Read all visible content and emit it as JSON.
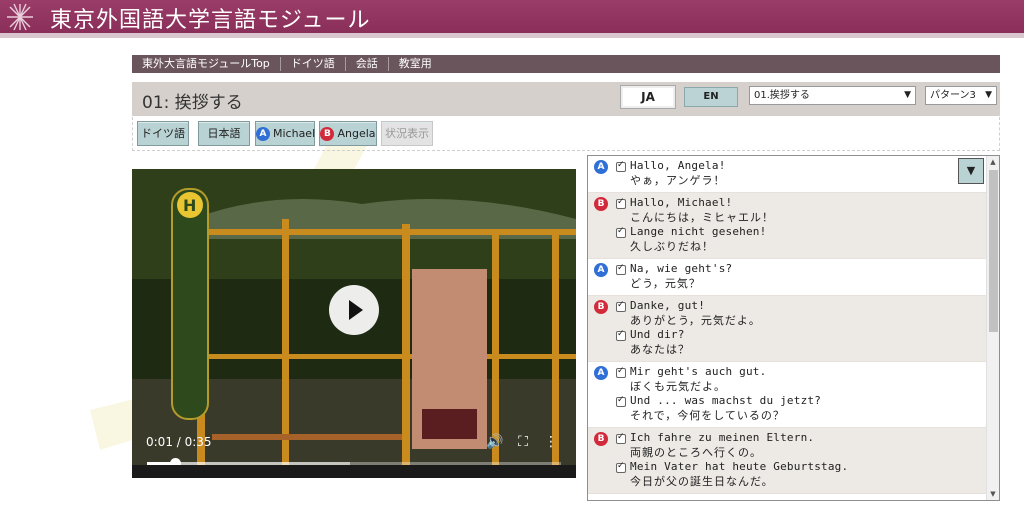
{
  "header": {
    "title": "東京外国語大学言語モジュール",
    "logo_icon": "snowflake-star-icon",
    "color_banner": "#8f3260"
  },
  "nav": {
    "items": [
      {
        "label": "東外大言語モジュールTop"
      },
      {
        "label": "ドイツ語"
      },
      {
        "label": "会話"
      },
      {
        "label": "教室用"
      }
    ]
  },
  "lesson": {
    "title": "01: 挨拶する",
    "lang_ja": "JA",
    "lang_en": "EN",
    "lesson_select": "01.挨拶する",
    "pattern_select": "パターン3"
  },
  "filters": {
    "german": "ドイツ語",
    "japanese": "日本語",
    "speaker_a_badge": "A",
    "speaker_a": "Michael",
    "speaker_b_badge": "B",
    "speaker_b": "Angela",
    "status": "状況表示"
  },
  "video": {
    "time": "0:01 / 0:35",
    "progress_fraction": 0.067,
    "buffered_fraction": 0.49,
    "volume_icon": "volume-icon",
    "fullscreen_icon": "fullscreen-icon",
    "menu_icon": "more-vert-icon",
    "play_icon": "play-icon"
  },
  "transcript": {
    "collapse_label": "▼",
    "turns": [
      {
        "speaker": "A",
        "lines": [
          {
            "de": "Hallo, Angela!",
            "ja": "やぁ，アンゲラ！"
          }
        ]
      },
      {
        "speaker": "B",
        "lines": [
          {
            "de": "Hallo, Michael!",
            "ja": "こんにちは，ミヒャエル！"
          },
          {
            "de": "Lange nicht gesehen!",
            "ja": "久しぶりだね！"
          }
        ]
      },
      {
        "speaker": "A",
        "lines": [
          {
            "de": "Na, wie geht's?",
            "ja": "どう，元気？"
          }
        ]
      },
      {
        "speaker": "B",
        "lines": [
          {
            "de": "Danke, gut!",
            "ja": "ありがとう，元気だよ。"
          },
          {
            "de": "Und dir?",
            "ja": "あなたは？"
          }
        ]
      },
      {
        "speaker": "A",
        "lines": [
          {
            "de": "Mir geht's auch gut.",
            "ja": "ぼくも元気だよ。"
          },
          {
            "de": "Und ... was machst du jetzt?",
            "ja": "それで，今何をしているの？"
          }
        ]
      },
      {
        "speaker": "B",
        "lines": [
          {
            "de": "Ich fahre zu meinen Eltern.",
            "ja": "両親のところへ行くの。"
          },
          {
            "de": "Mein Vater hat heute Geburtstag.",
            "ja": "今日が父の誕生日なんだ。"
          }
        ]
      }
    ]
  },
  "colors": {
    "speaker_a": "#2f6fd6",
    "speaker_b": "#d22a3a",
    "button_teal": "#b9d2d4",
    "navbar": "#6b555c"
  }
}
